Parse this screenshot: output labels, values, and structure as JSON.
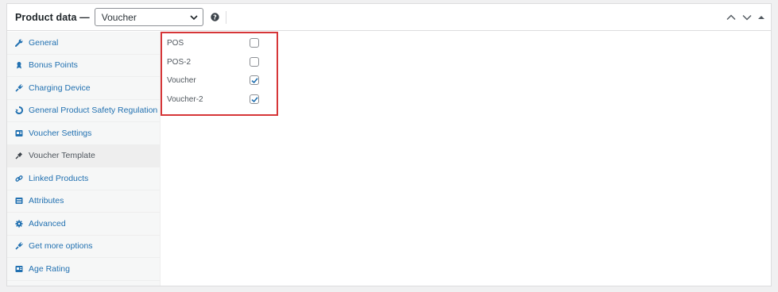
{
  "header": {
    "title": "Product data —",
    "product_type": "Voucher"
  },
  "icons": {
    "help": "question-circle-icon",
    "move_up": "chevron-up-icon",
    "move_down": "chevron-down-icon",
    "toggle": "caret-up-icon"
  },
  "sidebar": {
    "items": [
      {
        "label": "General",
        "icon": "wrench-icon",
        "active": false
      },
      {
        "label": "Bonus Points",
        "icon": "award-icon",
        "active": false
      },
      {
        "label": "Charging Device",
        "icon": "plug-icon",
        "active": false
      },
      {
        "label": "General Product Safety Regulation",
        "icon": "shield-icon",
        "active": false
      },
      {
        "label": "Voucher Settings",
        "icon": "id-card-icon",
        "active": false
      },
      {
        "label": "Voucher Template",
        "icon": "pin-icon",
        "active": true
      },
      {
        "label": "Linked Products",
        "icon": "link-icon",
        "active": false
      },
      {
        "label": "Attributes",
        "icon": "list-icon",
        "active": false
      },
      {
        "label": "Advanced",
        "icon": "gear-icon",
        "active": false
      },
      {
        "label": "Get more options",
        "icon": "plug-icon",
        "active": false
      },
      {
        "label": "Age Rating",
        "icon": "id-card-icon",
        "active": false
      }
    ]
  },
  "options": [
    {
      "label": "POS",
      "checked": false
    },
    {
      "label": "POS-2",
      "checked": false
    },
    {
      "label": "Voucher",
      "checked": true
    },
    {
      "label": "Voucher-2",
      "checked": true
    }
  ],
  "colors": {
    "link": "#2271b1",
    "highlight": "#d63638",
    "sidebar_bg": "#f6f7f7"
  }
}
